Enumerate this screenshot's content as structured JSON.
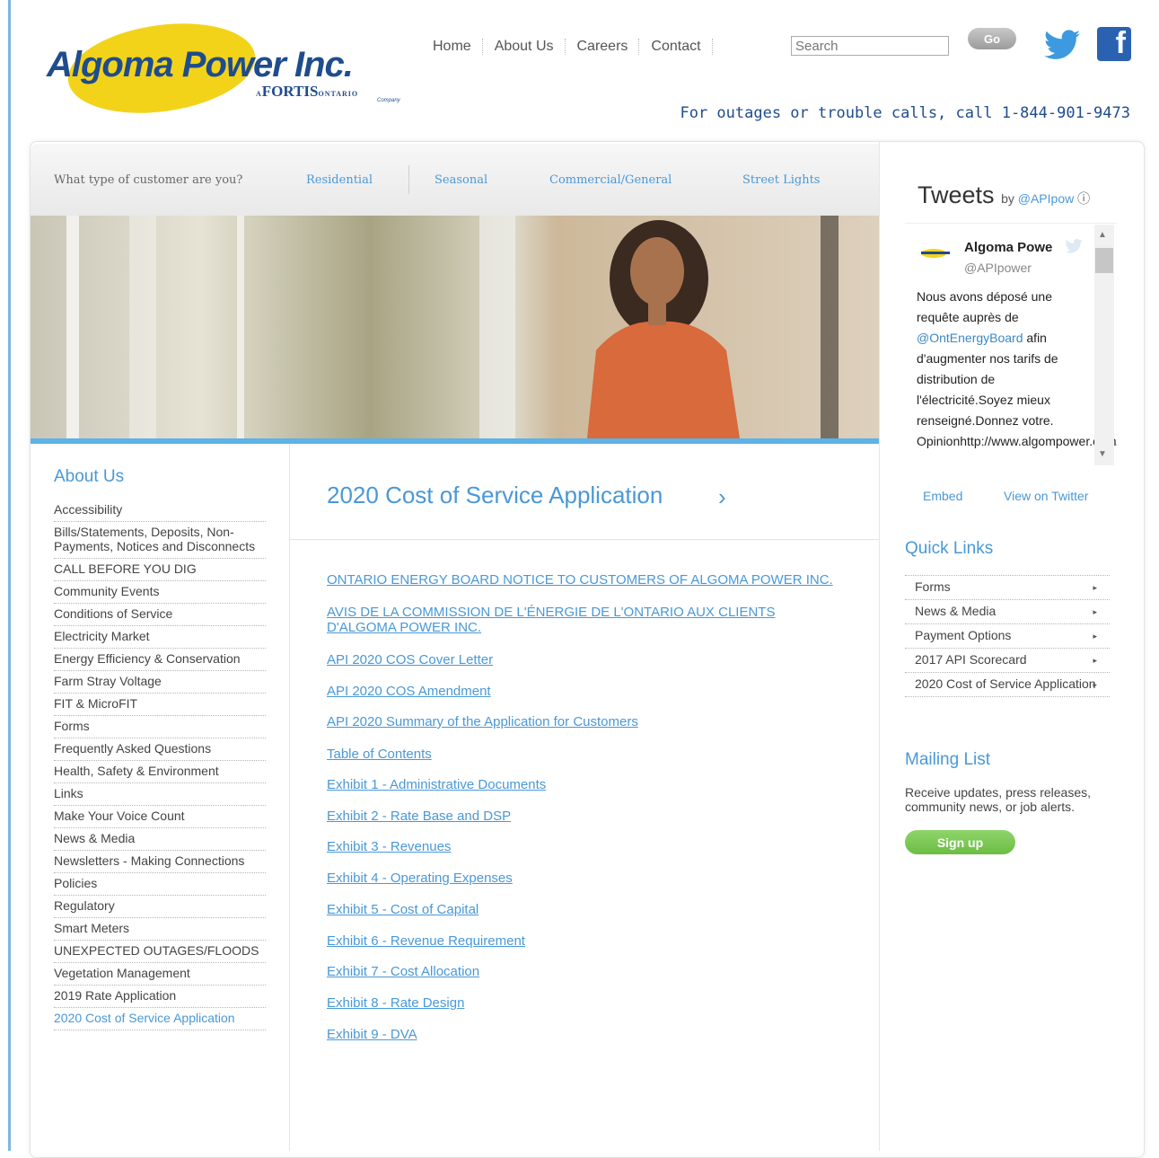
{
  "logo": {
    "brand": "Algoma Power Inc.",
    "sub": "FORTIS",
    "sub_small": "ONTARIO",
    "prefix": "A",
    "tiny": "Company"
  },
  "nav": {
    "home": "Home",
    "about": "About Us",
    "careers": "Careers",
    "contact": "Contact"
  },
  "search": {
    "placeholder": "Search",
    "go": "Go"
  },
  "outage_text": "For outages or trouble calls, call 1-844-901-9473",
  "customer_bar": {
    "question": "What type of customer are you?",
    "types": [
      "Residential",
      "Seasonal",
      "Commercial/General",
      "Street Lights"
    ]
  },
  "sidebar": {
    "heading": "About Us",
    "items": [
      "Accessibility",
      "Bills/Statements, Deposits, Non-Payments, Notices and Disconnects",
      "CALL BEFORE YOU DIG",
      "Community Events",
      "Conditions of Service",
      "Electricity Market",
      "Energy Efficiency & Conservation",
      "Farm Stray Voltage",
      "FIT & MicroFIT",
      "Forms",
      "Frequently Asked Questions",
      "Health, Safety & Environment",
      "Links",
      "Make Your Voice Count",
      "News & Media",
      "Newsletters - Making Connections",
      "Policies",
      "Regulatory",
      "Smart Meters",
      "UNEXPECTED OUTAGES/FLOODS",
      "Vegetation Management",
      "2019 Rate Application",
      "2020 Cost of Service Application"
    ]
  },
  "content": {
    "title": "2020 Cost of Service Application",
    "chevron": "›",
    "docs": [
      "ONTARIO ENERGY BOARD NOTICE TO CUSTOMERS OF ALGOMA POWER INC.",
      "AVIS DE LA COMMISSION DE L'ÉNERGIE DE L'ONTARIO AUX CLIENTS D'ALGOMA POWER INC.",
      "API 2020 COS Cover Letter",
      "API 2020 COS Amendment",
      "API 2020 Summary of the Application for Customers",
      "Table of Contents",
      "Exhibit 1 - Administrative Documents",
      "Exhibit 2 - Rate Base and DSP",
      "Exhibit 3 - Revenues",
      "Exhibit 4 - Operating Expenses",
      "Exhibit 5 - Cost of Capital",
      "Exhibit 6 - Revenue Requirement",
      "Exhibit 7 - Cost Allocation",
      "Exhibit 8 - Rate Design",
      "Exhibit 9  - DVA"
    ]
  },
  "tweets": {
    "heading": "Tweets",
    "by": "by",
    "by_handle": "@APIpow",
    "name": "Algoma Powe",
    "handle": "@APIpower",
    "text_1": "Nous avons déposé une requête auprès de ",
    "mention": "@OntEnergyBoard",
    "text_2": " afin d'augmenter nos tarifs de distribution de l'électricité.Soyez mieux renseigné.Donnez votre. Opinionhttp://www.algompower.com/Userfiles/File",
    "embed": "Embed",
    "view": "View on Twitter"
  },
  "quick_links": {
    "heading": "Quick Links",
    "items": [
      "Forms",
      "News & Media",
      "Payment Options",
      "2017 API Scorecard",
      "2020 Cost of Service Application"
    ]
  },
  "mailing": {
    "heading": "Mailing List",
    "text": "Receive updates, press releases, community news, or job alerts.",
    "button": "Sign up"
  },
  "colors": {
    "accent": "#4a98d6",
    "brand": "#1f4c8d",
    "logo_yellow": "#f3d31a",
    "signup_green": "#6cbd45"
  }
}
